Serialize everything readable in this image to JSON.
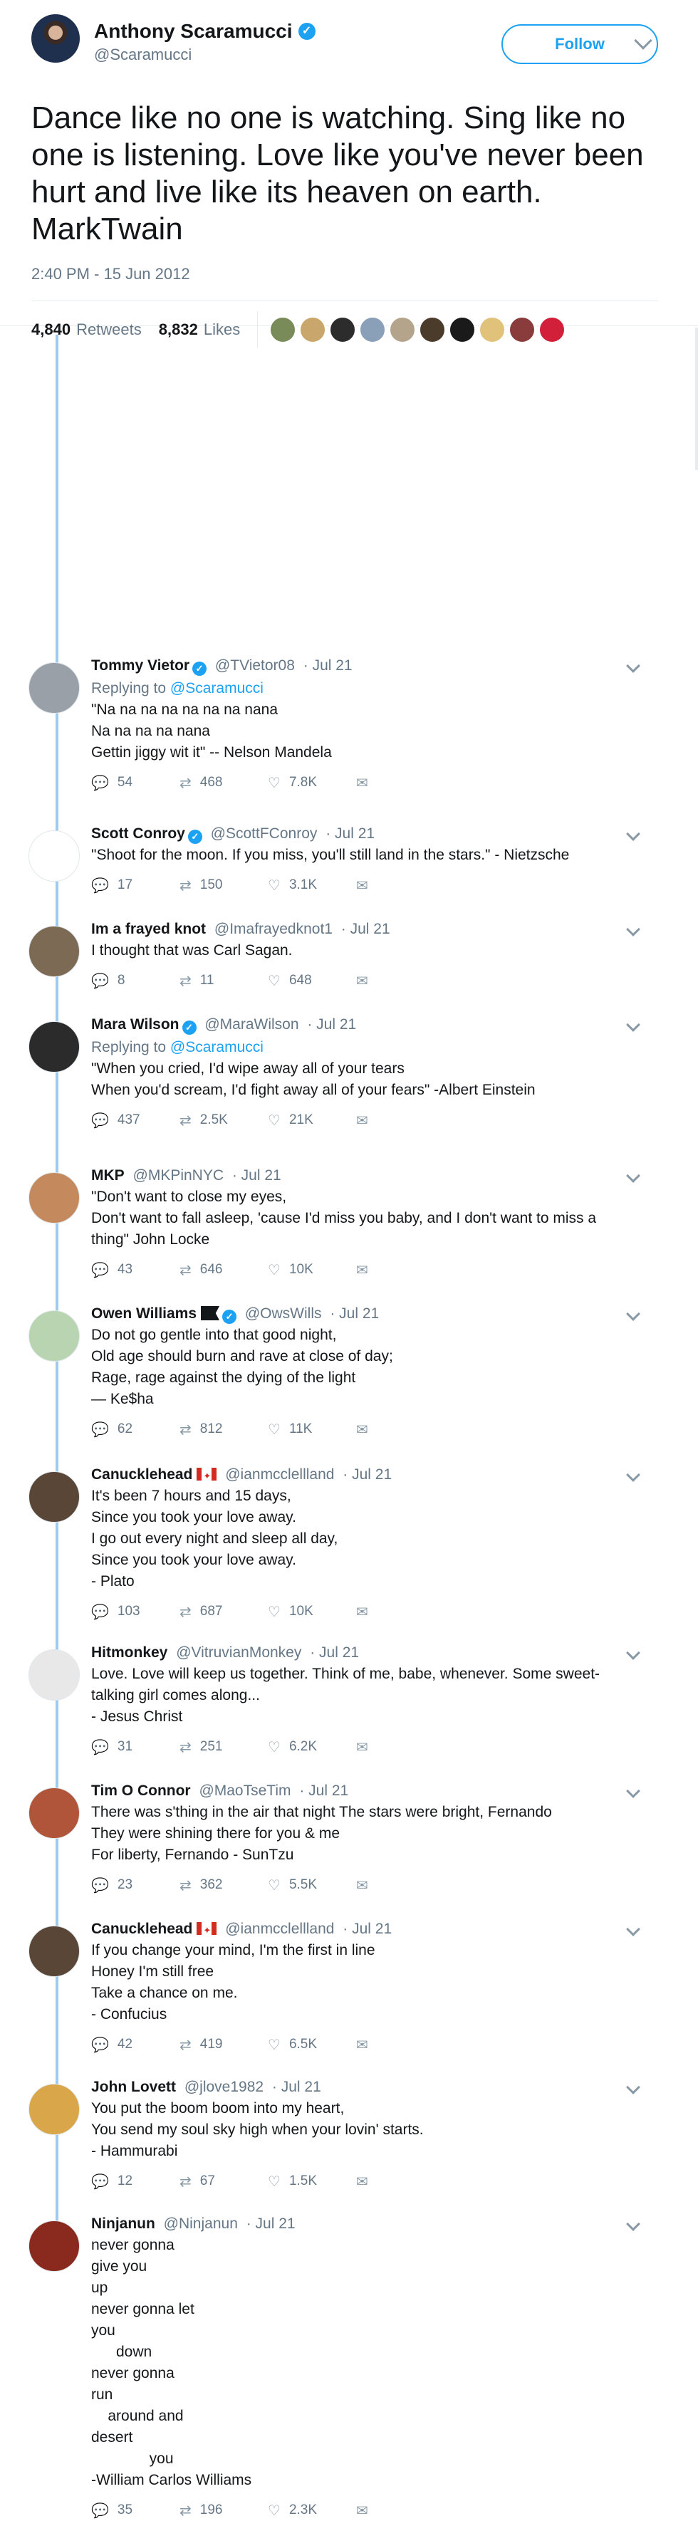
{
  "main": {
    "author_name": "Anthony Scaramucci",
    "author_handle": "@Scaramucci",
    "follow_label": "Follow",
    "text": "Dance like no one is watching. Sing like no\none is listening. Love like you've never been\nhurt and live like its heaven on earth.\nMarkTwain",
    "timestamp": "2:40 PM - 15 Jun 2012",
    "retweets_count": "4,840",
    "retweets_label": "Retweets",
    "likes_count": "8,832",
    "likes_label": "Likes",
    "liker_colors": [
      "#7a8b5a",
      "#c9a66b",
      "#2c2c2c",
      "#8aa0b8",
      "#b5a48c",
      "#4a3b2a",
      "#1a1a1a",
      "#e0c27a",
      "#8a3b3b",
      "#d3203a"
    ]
  },
  "colors": {
    "accent": "#1da1f2",
    "thread": "#9ecbef",
    "muted": "#657786"
  },
  "replies": [
    {
      "name": "Tommy Vietor",
      "verified": true,
      "flag": "",
      "handle": "@TVietor08",
      "date": "· Jul 21",
      "replying_to": "@Scaramucci",
      "text": "\"Na na na na na na na nana\nNa na na na nana\nGettin jiggy wit it\" -- Nelson Mandela",
      "replies": "54",
      "retweets": "468",
      "likes": "7.8K",
      "avatar_color": "#9aa0a8"
    },
    {
      "name": "Scott Conroy",
      "verified": true,
      "flag": "",
      "handle": "@ScottFConroy",
      "date": "· Jul 21",
      "replying_to": "",
      "text": "\"Shoot for the moon. If you miss, you'll still land in the stars.\" - Nietzsche",
      "replies": "17",
      "retweets": "150",
      "likes": "3.1K",
      "avatar_color": "#ffffff"
    },
    {
      "name": "Im a frayed knot",
      "verified": false,
      "flag": "",
      "handle": "@Imafrayedknot1",
      "date": "· Jul 21",
      "replying_to": "",
      "text": "I thought that was Carl Sagan.",
      "replies": "8",
      "retweets": "11",
      "likes": "648",
      "avatar_color": "#7d6a55"
    },
    {
      "name": "Mara Wilson",
      "verified": true,
      "flag": "",
      "handle": "@MaraWilson",
      "date": "· Jul 21",
      "replying_to": "@Scaramucci",
      "text": "\"When you cried, I'd wipe away all of your tears\nWhen you'd scream, I'd fight away all of your fears\" -Albert Einstein",
      "replies": "437",
      "retweets": "2.5K",
      "likes": "21K",
      "avatar_color": "#2b2b2b"
    },
    {
      "name": "MKP",
      "verified": false,
      "flag": "",
      "handle": "@MKPinNYC",
      "date": "· Jul 21",
      "replying_to": "",
      "text": "\"Don't want to close my eyes,\nDon't want to fall asleep, 'cause I'd miss you baby, and I don't want to miss a\nthing\" John Locke",
      "replies": "43",
      "retweets": "646",
      "likes": "10K",
      "avatar_color": "#c48a5e"
    },
    {
      "name": "Owen Williams",
      "verified": true,
      "flag": "black",
      "handle": "@OwsWills",
      "date": "· Jul 21",
      "replying_to": "",
      "text": "Do not go gentle into that good night,\nOld age should burn and rave at close of day;\nRage, rage against the dying of the light\n— Ke$ha",
      "replies": "62",
      "retweets": "812",
      "likes": "11K",
      "avatar_color": "#b8d4b0"
    },
    {
      "name": "Canucklehead",
      "verified": false,
      "flag": "ca",
      "handle": "@ianmcclellland",
      "date": "· Jul 21",
      "replying_to": "",
      "text": "It's been 7 hours and 15 days,\nSince you took your love away.\nI go out every night and sleep all day,\nSince you took your love away.\n- Plato",
      "replies": "103",
      "retweets": "687",
      "likes": "10K",
      "avatar_color": "#5a4636"
    },
    {
      "name": "Hitmonkey",
      "verified": false,
      "flag": "",
      "handle": "@VitruvianMonkey",
      "date": "· Jul 21",
      "replying_to": "",
      "text": "Love. Love will keep us together. Think of me, babe, whenever. Some sweet-\ntalking girl comes along...\n- Jesus Christ",
      "replies": "31",
      "retweets": "251",
      "likes": "6.2K",
      "avatar_color": "#e8e8e8"
    },
    {
      "name": "Tim O Connor",
      "verified": false,
      "flag": "",
      "handle": "@MaoTseTim",
      "date": "· Jul 21",
      "replying_to": "",
      "text": "There was s'thing in the air that night The stars were bright, Fernando\nThey were shining there for you & me\nFor liberty, Fernando - SunTzu",
      "replies": "23",
      "retweets": "362",
      "likes": "5.5K",
      "avatar_color": "#b0543a"
    },
    {
      "name": "Canucklehead",
      "verified": false,
      "flag": "ca",
      "handle": "@ianmcclellland",
      "date": "· Jul 21",
      "replying_to": "",
      "text": "If you change your mind, I'm the first in line\nHoney I'm still free\nTake a chance on me.\n- Confucius",
      "replies": "42",
      "retweets": "419",
      "likes": "6.5K",
      "avatar_color": "#5a4636"
    },
    {
      "name": "John Lovett",
      "verified": false,
      "flag": "",
      "handle": "@jlove1982",
      "date": "· Jul 21",
      "replying_to": "",
      "text": "You put the boom boom into my heart,\nYou send my soul sky high when your lovin' starts.\n- Hammurabi",
      "replies": "12",
      "retweets": "67",
      "likes": "1.5K",
      "avatar_color": "#d9a64a"
    },
    {
      "name": "Ninjanun",
      "verified": false,
      "flag": "",
      "handle": "@Ninjanun",
      "date": "· Jul 21",
      "replying_to": "",
      "text": "never gonna\ngive you\nup\nnever gonna let\nyou\n      down\nnever gonna\nrun\n    around and\ndesert\n              you\n-William Carlos Williams",
      "replies": "35",
      "retweets": "196",
      "likes": "2.3K",
      "avatar_color": "#8a2a1f"
    }
  ]
}
